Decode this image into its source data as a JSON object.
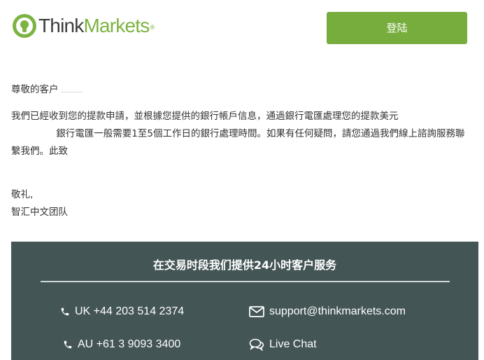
{
  "header": {
    "logo": {
      "think": "Think",
      "markets": "Markets",
      "registered": "®"
    },
    "login_label": "登陆"
  },
  "email": {
    "greeting": "尊敬的客户",
    "body_part1": "我們已經收到您的提款申請，並根據您提供的銀行帳戶信息，通過銀行電匯處理您的提款美元",
    "body_part2": "銀行電匯一般需要1至5個工作日的銀行處理時間。如果有任何疑問，請您通過我們線上諮詢服務聯繫我們。此致",
    "closing": "敬礼,",
    "signature": "智汇中文团队"
  },
  "footer": {
    "title": "在交易时段我们提供24小时客户服务",
    "phone_uk": "UK +44 203 514 2374",
    "phone_au": "AU +61 3 9093 3400",
    "email": "support@thinkmarkets.com",
    "chat": "Live Chat"
  },
  "colors": {
    "brand_green": "#7cb342",
    "button_green": "#76ad3c",
    "footer_bg": "#445556",
    "text": "#333333"
  },
  "icons": [
    "logo-bulb-icon",
    "phone-icon",
    "envelope-icon",
    "chat-bubble-icon"
  ]
}
